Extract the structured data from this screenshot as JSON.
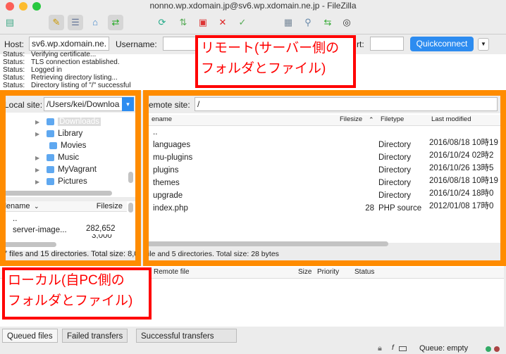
{
  "window": {
    "title": "nonno.wp.xdomain.jp@sv6.wp.xdomain.ne.jp - FileZilla"
  },
  "toolbar": {
    "icons": [
      "site-manager-icon",
      "message-log-icon",
      "local-tree-icon",
      "remote-tree-icon",
      "transfer-queue-icon",
      "refresh-icon",
      "process-queue-icon",
      "cancel-icon",
      "disconnect-icon",
      "reconnect-icon",
      "filter-icon",
      "compare-icon",
      "sync-browse-icon",
      "search-icon"
    ]
  },
  "quickconnect": {
    "host_label": "Host:",
    "host_value": "sv6.wp.xdomain.ne.",
    "username_label": "Username:",
    "port_label": "rt:",
    "button": "Quickconnect"
  },
  "log": [
    {
      "k": "Status:",
      "v": "Verifying certificate..."
    },
    {
      "k": "Status:",
      "v": "TLS connection established."
    },
    {
      "k": "Status:",
      "v": "Logged in"
    },
    {
      "k": "Status:",
      "v": "Retrieving directory listing..."
    },
    {
      "k": "Status:",
      "v": "Directory listing of \"/\" successful"
    }
  ],
  "annotations": {
    "remote": [
      "リモート(サーバー側の",
      "フォルダとファイル)"
    ],
    "local": [
      "ローカル(自PC側の",
      "フォルダとファイル)"
    ]
  },
  "local": {
    "label": "Local site:",
    "path": "/Users/kei/Downloa",
    "tree": [
      "Downloads",
      "Library",
      "Movies",
      "Music",
      "MyVagrant",
      "Pictures"
    ],
    "col_filename": "ilename",
    "col_filesize": "Filesize",
    "files": [
      {
        "name": "..",
        "size": ""
      },
      {
        "name": "server-image...",
        "size": "282,652"
      },
      {
        "name": "",
        "size": "3,000"
      }
    ],
    "status": "7 files and 15 directories. Total size: 8,0"
  },
  "remote": {
    "label": "emote site:",
    "path": "/",
    "col_filename": "ename",
    "col_filesize": "Filesize",
    "col_filetype": "Filetype",
    "col_modified": "Last modified",
    "files": [
      {
        "name": "..",
        "size": "",
        "type": "",
        "modified": ""
      },
      {
        "name": "languages",
        "size": "",
        "type": "Directory",
        "modified": "2016/08/18 10時19"
      },
      {
        "name": "mu-plugins",
        "size": "",
        "type": "Directory",
        "modified": "2016/10/24 02時2"
      },
      {
        "name": "plugins",
        "size": "",
        "type": "Directory",
        "modified": "2016/10/26 13時5"
      },
      {
        "name": "themes",
        "size": "",
        "type": "Directory",
        "modified": "2016/08/18 10時19"
      },
      {
        "name": "upgrade",
        "size": "",
        "type": "Directory",
        "modified": "2016/10/24 18時0"
      },
      {
        "name": "index.php",
        "size": "28",
        "type": "PHP source",
        "modified": "2012/01/08 17時0"
      }
    ],
    "status": "file and 5 directories. Total size: 28 bytes"
  },
  "queue": {
    "col_remote": "Remote file",
    "col_size": "Size",
    "col_priority": "Priority",
    "col_status": "Status",
    "tabs": [
      "Queued files",
      "Failed transfers",
      "Successful transfers"
    ],
    "status": "Queue: empty"
  }
}
